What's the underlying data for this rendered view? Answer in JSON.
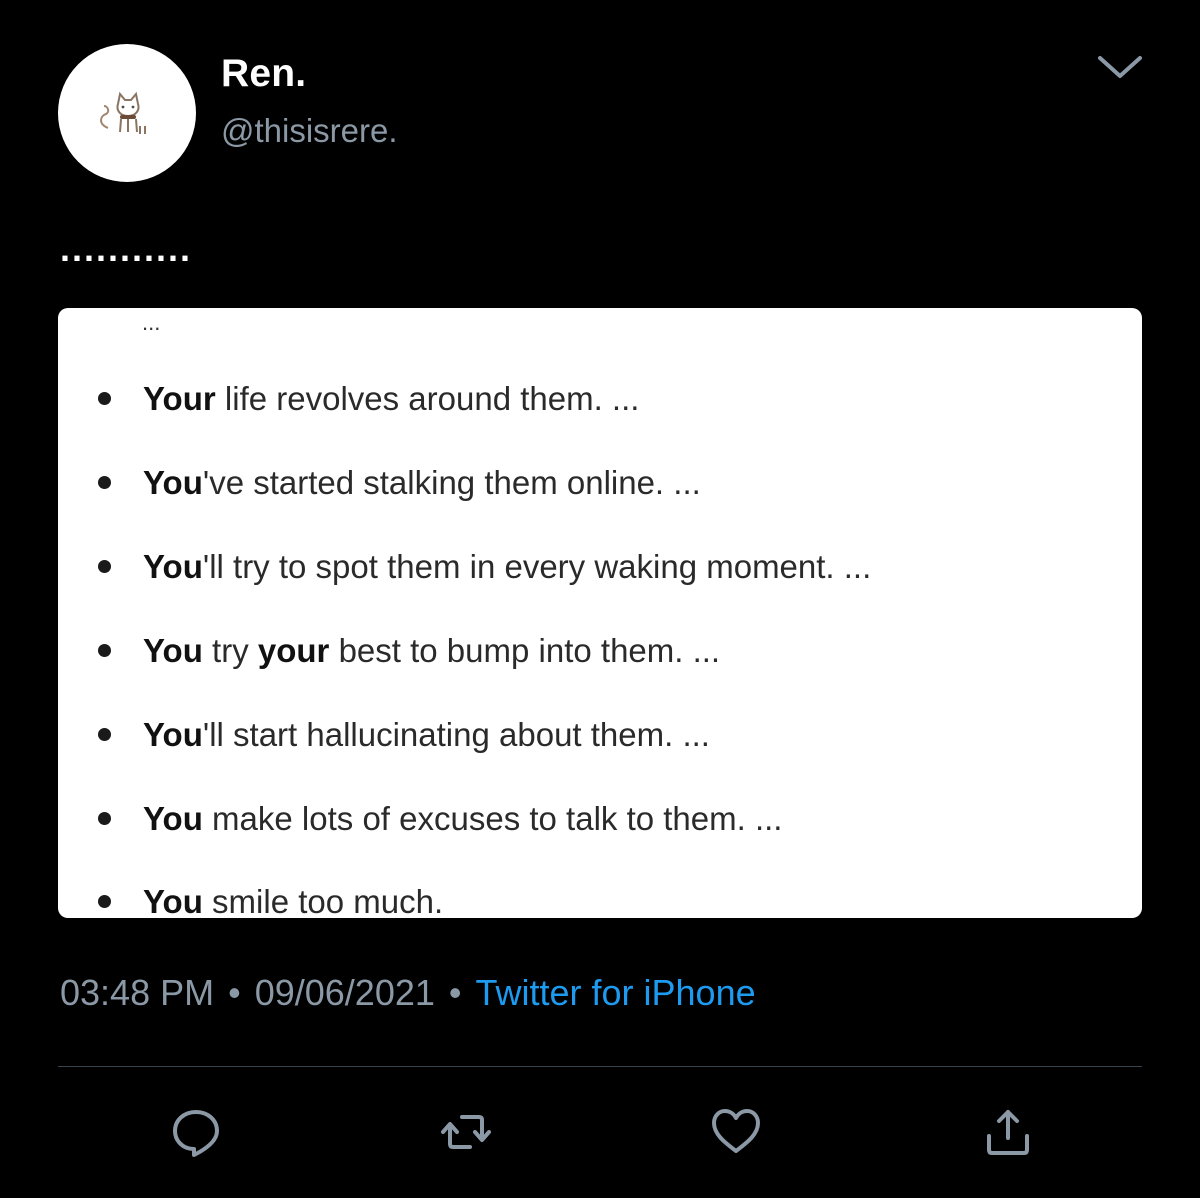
{
  "user": {
    "display_name": "Ren.",
    "handle": "@thisisrere.",
    "avatar_icon": "cat-avatar-icon"
  },
  "tweet": {
    "text": "..........."
  },
  "media": {
    "top_ellipsis": "...",
    "items": [
      {
        "bold1": "Your",
        "rest": " life revolves around them. ..."
      },
      {
        "bold1": "You",
        "rest": "'ve started stalking them online. ..."
      },
      {
        "bold1": "You",
        "rest": "'ll try to spot them in every waking moment. ..."
      },
      {
        "bold1": "You",
        "mid": " try ",
        "bold2": "your",
        "rest": " best to bump into them. ..."
      },
      {
        "bold1": "You",
        "rest": "'ll start hallucinating about them. ..."
      },
      {
        "bold1": "You",
        "rest": " make lots of excuses to talk to them. ..."
      },
      {
        "bold1": "You",
        "rest": " smile too much."
      }
    ]
  },
  "meta": {
    "time": "03:48 PM",
    "separator": "•",
    "date": "09/06/2021",
    "source": "Twitter for iPhone"
  },
  "actions": {
    "reply_icon": "reply-icon",
    "retweet_icon": "retweet-icon",
    "like_icon": "heart-icon",
    "share_icon": "share-icon"
  },
  "colors": {
    "background": "#000000",
    "secondary_text": "#8b98a5",
    "link": "#1d9bf0",
    "divider": "#38444d"
  }
}
